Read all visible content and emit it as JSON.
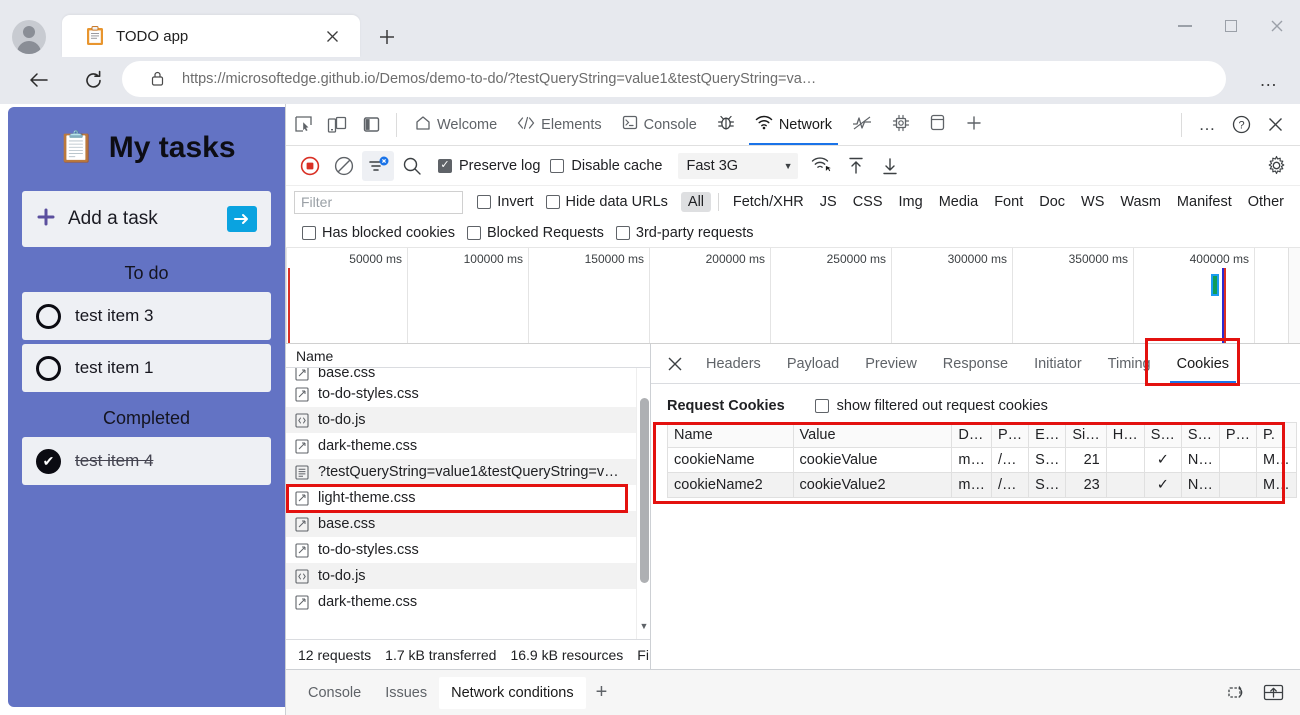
{
  "browser": {
    "tab": {
      "title": "TODO app",
      "favicon_icon": "clipboard-icon",
      "close_icon": "close-icon"
    },
    "new_tab_label": "+",
    "nav": {
      "back_icon": "back-arrow-icon",
      "reload_icon": "reload-icon",
      "lock_icon": "lock-icon"
    },
    "url": {
      "scheme": "https://",
      "domain": "microsoftedge.github.io",
      "path": "/Demos/demo-to-do/?testQueryString=value1&testQueryString=va…",
      "full": "https://microsoftedge.github.io/Demos/demo-to-do/?testQueryString=value1&testQueryString=va…"
    },
    "more_label": "…",
    "window_controls": {
      "minimize": "minimize-icon",
      "maximize": "maximize-icon",
      "close": "close-icon"
    }
  },
  "todo_app": {
    "title": "My tasks",
    "title_icon": "📋",
    "add_task": {
      "label": "Add a task",
      "plus": "✛",
      "submit_icon": "➡"
    },
    "sections": [
      {
        "heading": "To do",
        "items": [
          {
            "label": "test item 3",
            "completed": false
          },
          {
            "label": "test item 1",
            "completed": false
          }
        ]
      },
      {
        "heading": "Completed",
        "items": [
          {
            "label": "test item 4",
            "completed": true
          }
        ]
      }
    ]
  },
  "devtools": {
    "left_icons": [
      "inspect-element-icon",
      "device-toolbar-icon",
      "dock-side-icon"
    ],
    "panel_tabs": [
      {
        "label": "Welcome",
        "icon": "home-icon",
        "active": false
      },
      {
        "label": "Elements",
        "icon": "code-brackets-icon",
        "active": false
      },
      {
        "label": "Console",
        "icon": "console-prompt-icon",
        "active": false
      },
      {
        "label": "",
        "icon": "bug-icon",
        "active": false
      },
      {
        "label": "Network",
        "icon": "network-wifi-icon",
        "active": true
      },
      {
        "label": "",
        "icon": "performance-icon",
        "active": false
      },
      {
        "label": "",
        "icon": "memory-chip-icon",
        "active": false
      },
      {
        "label": "",
        "icon": "application-icon",
        "active": false
      },
      {
        "label": "",
        "icon": "plus-icon",
        "active": false
      }
    ],
    "tabbar_right": [
      {
        "icon": "more-options-icon",
        "label": "…"
      },
      {
        "icon": "help-icon",
        "label": "?"
      },
      {
        "icon": "close-devtools-icon",
        "label": "✕"
      }
    ],
    "toolbar": {
      "record_icon": "record-stop-icon",
      "clear_icon": "clear-network-icon",
      "filter_icon": "filter-icon",
      "search_icon": "search-icon",
      "preserve_log": {
        "label": "Preserve log",
        "checked": true
      },
      "disable_cache": {
        "label": "Disable cache",
        "checked": false
      },
      "throttling": {
        "value": "Fast 3G",
        "caret": "▼"
      },
      "network_conditions_icon": "network-conditions-icon",
      "import_har_icon": "upload-har-icon",
      "export_har_icon": "download-har-icon",
      "settings_icon": "gear-icon"
    },
    "filterbar": {
      "filter_placeholder": "Filter",
      "invert": {
        "label": "Invert",
        "checked": false
      },
      "hide_data_urls": {
        "label": "Hide data URLs",
        "checked": false
      },
      "types": [
        "All",
        "Fetch/XHR",
        "JS",
        "CSS",
        "Img",
        "Media",
        "Font",
        "Doc",
        "WS",
        "Wasm",
        "Manifest",
        "Other"
      ],
      "selected_type": "All",
      "has_blocked_cookies": {
        "label": "Has blocked cookies",
        "checked": false
      },
      "blocked_requests": {
        "label": "Blocked Requests",
        "checked": false
      },
      "third_party_requests": {
        "label": "3rd-party requests",
        "checked": false
      }
    },
    "overview": {
      "ticks": [
        "50000 ms",
        "100000 ms",
        "150000 ms",
        "200000 ms",
        "250000 ms",
        "300000 ms",
        "350000 ms",
        "400000 ms"
      ],
      "marker_color": "#d93025",
      "load_marker_color": "#2b2bd0",
      "bar_color": "#1a9cf0"
    },
    "requests": {
      "column_header": "Name",
      "rows": [
        {
          "name": "base.css",
          "icon": "stylesheet-icon",
          "selected": false,
          "partial": true
        },
        {
          "name": "to-do-styles.css",
          "icon": "stylesheet-icon",
          "selected": false
        },
        {
          "name": "to-do.js",
          "icon": "script-icon",
          "selected": false
        },
        {
          "name": "dark-theme.css",
          "icon": "stylesheet-icon",
          "selected": false
        },
        {
          "name": "?testQueryString=value1&testQueryString=v…",
          "icon": "document-icon",
          "selected": true
        },
        {
          "name": "light-theme.css",
          "icon": "stylesheet-icon",
          "selected": false
        },
        {
          "name": "base.css",
          "icon": "stylesheet-icon",
          "selected": false
        },
        {
          "name": "to-do-styles.css",
          "icon": "stylesheet-icon",
          "selected": false
        },
        {
          "name": "to-do.js",
          "icon": "script-icon",
          "selected": false
        },
        {
          "name": "dark-theme.css",
          "icon": "stylesheet-icon",
          "selected": false
        }
      ],
      "status": {
        "requests": "12 requests",
        "transferred": "1.7 kB transferred",
        "resources": "16.9 kB resources",
        "finish": "Fin"
      }
    },
    "detail": {
      "close_icon": "close-icon",
      "tabs": [
        "Headers",
        "Payload",
        "Preview",
        "Response",
        "Initiator",
        "Timing",
        "Cookies"
      ],
      "active_tab": "Cookies",
      "cookies": {
        "section_title": "Request Cookies",
        "show_filtered_label": "show filtered out request cookies",
        "show_filtered_checked": false,
        "columns": [
          "Name",
          "Value",
          "D…",
          "P…",
          "E…",
          "Si…",
          "H…",
          "S…",
          "S…",
          "P…",
          "P."
        ],
        "rows": [
          {
            "name": "cookieName",
            "value": "cookieValue",
            "domain": "m…",
            "path": "/…",
            "expires": "S…",
            "size": "21",
            "httponly": "",
            "secure": "✓",
            "samesite": "N…",
            "partition": "",
            "priority": "M…"
          },
          {
            "name": "cookieName2",
            "value": "cookieValue2",
            "domain": "m…",
            "path": "/…",
            "expires": "S…",
            "size": "23",
            "httponly": "",
            "secure": "✓",
            "samesite": "N…",
            "partition": "",
            "priority": "M…"
          }
        ]
      }
    },
    "drawer": {
      "tabs": [
        {
          "label": "Console",
          "active": false
        },
        {
          "label": "Issues",
          "active": false
        },
        {
          "label": "Network conditions",
          "active": true
        }
      ],
      "plus": "+",
      "right_icons": [
        "restore-drawer-icon",
        "dock-bottom-icon"
      ]
    }
  },
  "annotations": {
    "highlight_color": "#e3110f",
    "boxes": [
      "selected-request-row",
      "cookies-tab",
      "cookies-table"
    ]
  }
}
